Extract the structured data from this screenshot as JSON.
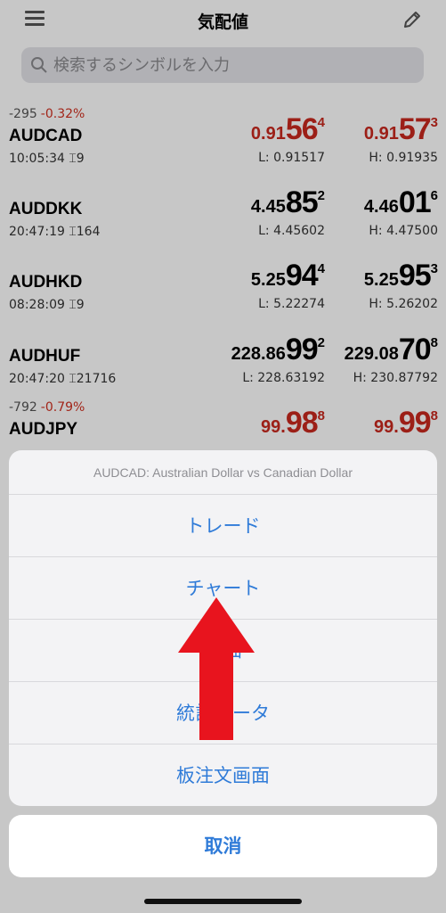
{
  "header": {
    "title": "気配値",
    "menu_icon": "list-icon",
    "edit_icon": "pencil-icon"
  },
  "search": {
    "placeholder": "検索するシンボルを入力"
  },
  "quotes": [
    {
      "change": "-295",
      "change_pct": "-0.32%",
      "symbol": "AUDCAD",
      "time": "10:05:34",
      "spread": "9",
      "bid": {
        "prefix": "0.91",
        "big": "56",
        "sup": "4"
      },
      "ask": {
        "prefix": "0.91",
        "big": "57",
        "sup": "3"
      },
      "low": "L: 0.91517",
      "high": "H: 0.91935",
      "color": "red"
    },
    {
      "change": "",
      "change_pct": "",
      "symbol": "AUDDKK",
      "time": "20:47:19",
      "spread": "164",
      "bid": {
        "prefix": "4.45",
        "big": "85",
        "sup": "2"
      },
      "ask": {
        "prefix": "4.46",
        "big": "01",
        "sup": "6"
      },
      "low": "L: 4.45602",
      "high": "H: 4.47500",
      "color": "black"
    },
    {
      "change": "",
      "change_pct": "",
      "symbol": "AUDHKD",
      "time": "08:28:09",
      "spread": "9",
      "bid": {
        "prefix": "5.25",
        "big": "94",
        "sup": "4"
      },
      "ask": {
        "prefix": "5.25",
        "big": "95",
        "sup": "3"
      },
      "low": "L: 5.22274",
      "high": "H: 5.26202",
      "color": "black"
    },
    {
      "change": "",
      "change_pct": "",
      "symbol": "AUDHUF",
      "time": "20:47:20",
      "spread": "21716",
      "bid": {
        "prefix": "228.86",
        "big": "99",
        "sup": "2"
      },
      "ask": {
        "prefix": "229.08",
        "big": "70",
        "sup": "8"
      },
      "low": "L: 228.63192",
      "high": "H: 230.87792",
      "color": "black"
    },
    {
      "change": "-792",
      "change_pct": "-0.79%",
      "symbol": "AUDJPY",
      "time": "",
      "spread": "",
      "bid": {
        "prefix": "99.",
        "big": "98",
        "sup": "8"
      },
      "ask": {
        "prefix": "99.",
        "big": "99",
        "sup": "8"
      },
      "low": "",
      "high": "",
      "color": "red"
    }
  ],
  "sheet": {
    "title": "AUDCAD: Australian Dollar vs Canadian Dollar",
    "actions": [
      "トレード",
      "チャート",
      "詳細",
      "統計データ",
      "板注文画面"
    ],
    "cancel": "取消"
  },
  "colors": {
    "accent": "#2f7bd8",
    "negative": "#c8281e",
    "arrow": "#e8141e"
  },
  "annotation": {
    "arrow_icon": "up-arrow-icon"
  }
}
